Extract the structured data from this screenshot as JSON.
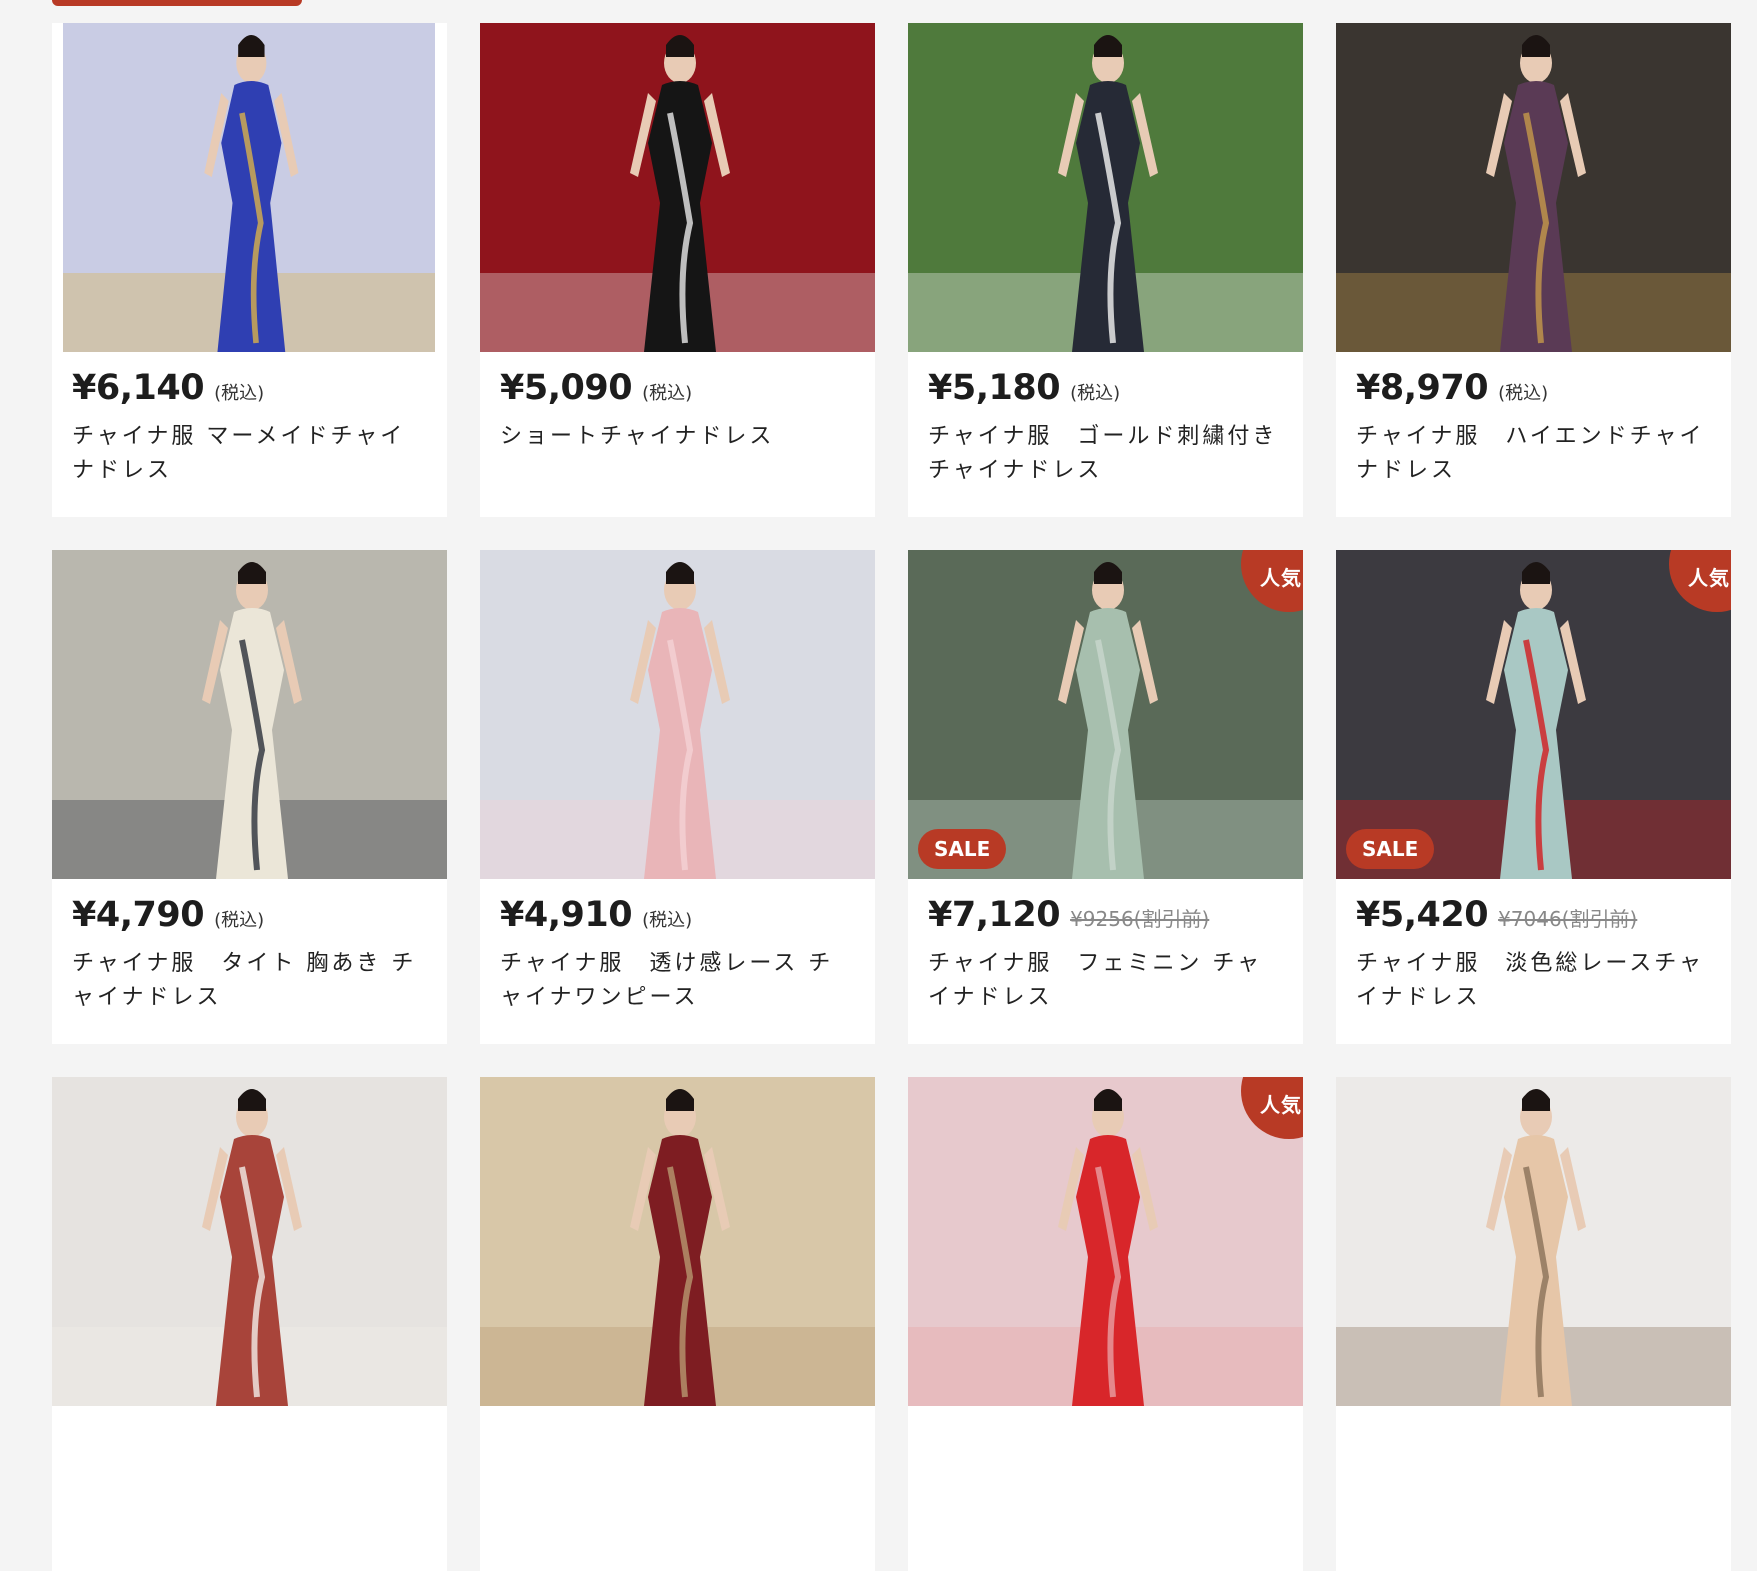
{
  "colors": {
    "accent": "#b83a25",
    "page_background": "#f4f4f4",
    "card_background": "#ffffff"
  },
  "products": [
    {
      "price": "¥6,140",
      "tax": "(税込)",
      "name": "チャイナ服 マーメイドチャイナドレス",
      "photo": {
        "bg": "#c9cce4",
        "garment": "#2f3fb2",
        "accent": "#d9b24a"
      }
    },
    {
      "price": "¥5,090",
      "tax": "(税込)",
      "name": "ショートチャイナドレス",
      "photo": {
        "bg": "#8f141c",
        "garment": "#151515",
        "accent": "#e8e8e8"
      }
    },
    {
      "price": "¥5,180",
      "tax": "(税込)",
      "name": "チャイナ服　ゴールド刺繍付きチャイナドレス",
      "photo": {
        "bg": "#4f7a3c",
        "garment": "#262a36",
        "accent": "#f4f4f4"
      }
    },
    {
      "price": "¥8,970",
      "tax": "(税込)",
      "name": "チャイナ服　ハイエンドチャイナドレス",
      "photo": {
        "bg": "#3a3530",
        "garment": "#5a3a55",
        "accent": "#c69a4a"
      }
    },
    {
      "price": "¥4,790",
      "tax": "(税込)",
      "name": "チャイナ服　タイト 胸あき チャイナドレス",
      "photo": {
        "bg": "#b9b7ae",
        "garment": "#ebe6d8",
        "accent": "#2a2f3a"
      }
    },
    {
      "price": "¥4,910",
      "tax": "(税込)",
      "name": "チャイナ服　透け感レース チャイナワンピース",
      "photo": {
        "bg": "#d9dbe3",
        "garment": "#e9b5b8",
        "accent": "#f4d2d4"
      }
    },
    {
      "price": "¥7,120",
      "original": "¥9256(割引前)",
      "name": "チャイナ服　フェミニン チャイナドレス",
      "badge_popular": "人気",
      "badge_sale": "SALE",
      "photo": {
        "bg": "#5a6a58",
        "garment": "#a7bfae",
        "accent": "#c9d7cd"
      }
    },
    {
      "price": "¥5,420",
      "original": "¥7046(割引前)",
      "name": "チャイナ服　淡色総レースチャイナドレス",
      "badge_popular": "人気",
      "badge_sale": "SALE",
      "photo": {
        "bg": "#3c3a40",
        "garment": "#a9c8c4",
        "accent": "#d21c1f"
      }
    },
    {
      "price": "",
      "name": "",
      "photo": {
        "bg": "#e6e3e0",
        "garment": "#a8443a",
        "accent": "#f2ede8"
      }
    },
    {
      "price": "",
      "name": "",
      "photo": {
        "bg": "#d8c7a8",
        "garment": "#7e1d22",
        "accent": "#b89870"
      }
    },
    {
      "price": "",
      "name": "",
      "badge_popular": "人気",
      "photo": {
        "bg": "#e7c9cd",
        "garment": "#d8262a",
        "accent": "#e9a0a4"
      }
    },
    {
      "price": "",
      "name": "",
      "photo": {
        "bg": "#eceae8",
        "garment": "#e6c6a8",
        "accent": "#8a7058"
      }
    }
  ]
}
